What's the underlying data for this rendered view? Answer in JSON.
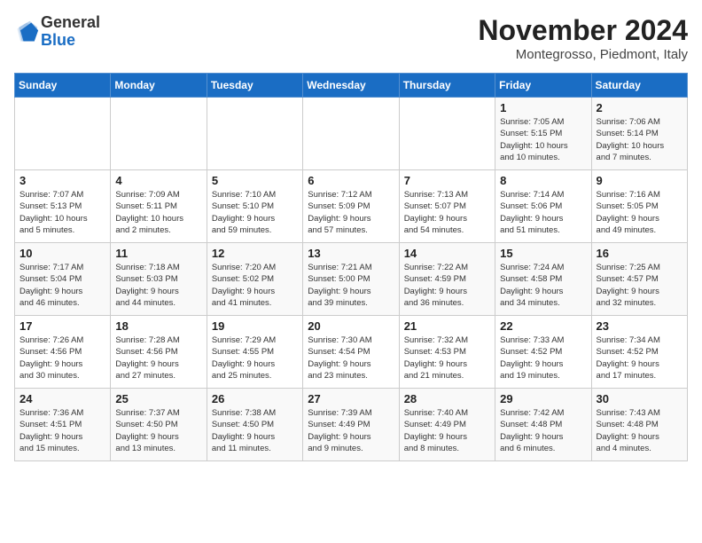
{
  "logo": {
    "general": "General",
    "blue": "Blue"
  },
  "title": {
    "month_year": "November 2024",
    "location": "Montegrosso, Piedmont, Italy"
  },
  "days_of_week": [
    "Sunday",
    "Monday",
    "Tuesday",
    "Wednesday",
    "Thursday",
    "Friday",
    "Saturday"
  ],
  "weeks": [
    [
      {
        "day": "",
        "info": ""
      },
      {
        "day": "",
        "info": ""
      },
      {
        "day": "",
        "info": ""
      },
      {
        "day": "",
        "info": ""
      },
      {
        "day": "",
        "info": ""
      },
      {
        "day": "1",
        "info": "Sunrise: 7:05 AM\nSunset: 5:15 PM\nDaylight: 10 hours\nand 10 minutes."
      },
      {
        "day": "2",
        "info": "Sunrise: 7:06 AM\nSunset: 5:14 PM\nDaylight: 10 hours\nand 7 minutes."
      }
    ],
    [
      {
        "day": "3",
        "info": "Sunrise: 7:07 AM\nSunset: 5:13 PM\nDaylight: 10 hours\nand 5 minutes."
      },
      {
        "day": "4",
        "info": "Sunrise: 7:09 AM\nSunset: 5:11 PM\nDaylight: 10 hours\nand 2 minutes."
      },
      {
        "day": "5",
        "info": "Sunrise: 7:10 AM\nSunset: 5:10 PM\nDaylight: 9 hours\nand 59 minutes."
      },
      {
        "day": "6",
        "info": "Sunrise: 7:12 AM\nSunset: 5:09 PM\nDaylight: 9 hours\nand 57 minutes."
      },
      {
        "day": "7",
        "info": "Sunrise: 7:13 AM\nSunset: 5:07 PM\nDaylight: 9 hours\nand 54 minutes."
      },
      {
        "day": "8",
        "info": "Sunrise: 7:14 AM\nSunset: 5:06 PM\nDaylight: 9 hours\nand 51 minutes."
      },
      {
        "day": "9",
        "info": "Sunrise: 7:16 AM\nSunset: 5:05 PM\nDaylight: 9 hours\nand 49 minutes."
      }
    ],
    [
      {
        "day": "10",
        "info": "Sunrise: 7:17 AM\nSunset: 5:04 PM\nDaylight: 9 hours\nand 46 minutes."
      },
      {
        "day": "11",
        "info": "Sunrise: 7:18 AM\nSunset: 5:03 PM\nDaylight: 9 hours\nand 44 minutes."
      },
      {
        "day": "12",
        "info": "Sunrise: 7:20 AM\nSunset: 5:02 PM\nDaylight: 9 hours\nand 41 minutes."
      },
      {
        "day": "13",
        "info": "Sunrise: 7:21 AM\nSunset: 5:00 PM\nDaylight: 9 hours\nand 39 minutes."
      },
      {
        "day": "14",
        "info": "Sunrise: 7:22 AM\nSunset: 4:59 PM\nDaylight: 9 hours\nand 36 minutes."
      },
      {
        "day": "15",
        "info": "Sunrise: 7:24 AM\nSunset: 4:58 PM\nDaylight: 9 hours\nand 34 minutes."
      },
      {
        "day": "16",
        "info": "Sunrise: 7:25 AM\nSunset: 4:57 PM\nDaylight: 9 hours\nand 32 minutes."
      }
    ],
    [
      {
        "day": "17",
        "info": "Sunrise: 7:26 AM\nSunset: 4:56 PM\nDaylight: 9 hours\nand 30 minutes."
      },
      {
        "day": "18",
        "info": "Sunrise: 7:28 AM\nSunset: 4:56 PM\nDaylight: 9 hours\nand 27 minutes."
      },
      {
        "day": "19",
        "info": "Sunrise: 7:29 AM\nSunset: 4:55 PM\nDaylight: 9 hours\nand 25 minutes."
      },
      {
        "day": "20",
        "info": "Sunrise: 7:30 AM\nSunset: 4:54 PM\nDaylight: 9 hours\nand 23 minutes."
      },
      {
        "day": "21",
        "info": "Sunrise: 7:32 AM\nSunset: 4:53 PM\nDaylight: 9 hours\nand 21 minutes."
      },
      {
        "day": "22",
        "info": "Sunrise: 7:33 AM\nSunset: 4:52 PM\nDaylight: 9 hours\nand 19 minutes."
      },
      {
        "day": "23",
        "info": "Sunrise: 7:34 AM\nSunset: 4:52 PM\nDaylight: 9 hours\nand 17 minutes."
      }
    ],
    [
      {
        "day": "24",
        "info": "Sunrise: 7:36 AM\nSunset: 4:51 PM\nDaylight: 9 hours\nand 15 minutes."
      },
      {
        "day": "25",
        "info": "Sunrise: 7:37 AM\nSunset: 4:50 PM\nDaylight: 9 hours\nand 13 minutes."
      },
      {
        "day": "26",
        "info": "Sunrise: 7:38 AM\nSunset: 4:50 PM\nDaylight: 9 hours\nand 11 minutes."
      },
      {
        "day": "27",
        "info": "Sunrise: 7:39 AM\nSunset: 4:49 PM\nDaylight: 9 hours\nand 9 minutes."
      },
      {
        "day": "28",
        "info": "Sunrise: 7:40 AM\nSunset: 4:49 PM\nDaylight: 9 hours\nand 8 minutes."
      },
      {
        "day": "29",
        "info": "Sunrise: 7:42 AM\nSunset: 4:48 PM\nDaylight: 9 hours\nand 6 minutes."
      },
      {
        "day": "30",
        "info": "Sunrise: 7:43 AM\nSunset: 4:48 PM\nDaylight: 9 hours\nand 4 minutes."
      }
    ]
  ]
}
